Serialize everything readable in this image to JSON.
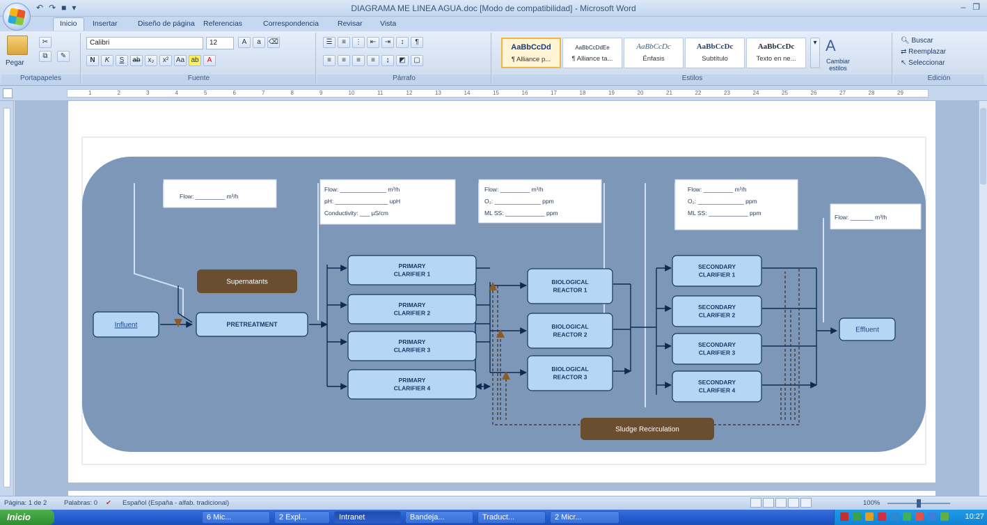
{
  "window": {
    "title": "DIAGRAMA ME LINEA AGUA.doc [Modo de compatibilidad] - Microsoft Word"
  },
  "tabs": [
    "Inicio",
    "Insertar",
    "Diseño de página",
    "Referencias",
    "Correspondencia",
    "Revisar",
    "Vista"
  ],
  "ribbon": {
    "clipboard": {
      "paste": "Pegar",
      "label": "Portapapeles"
    },
    "font": {
      "name": "Calibri",
      "size": "12",
      "label": "Fuente"
    },
    "paragraph": {
      "label": "Párrafo"
    },
    "styles": {
      "label": "Estilos",
      "items": [
        {
          "sample": "AaBbCcDd",
          "name": "¶ Alliance p..."
        },
        {
          "sample": "AaBbCcDdEe",
          "name": "¶ Alliance ta..."
        },
        {
          "sample": "AaBbCcDc",
          "name": "Énfasis"
        },
        {
          "sample": "AaBbCcDc",
          "name": "Subtítulo"
        },
        {
          "sample": "AaBbCcDc",
          "name": "Texto en ne..."
        }
      ],
      "change": "Cambiar estilos"
    },
    "editing": {
      "label": "Edición",
      "find": "Buscar",
      "replace": "Reemplazar",
      "select": "Seleccionar"
    }
  },
  "ruler": {
    "ticks": [
      "1",
      "2",
      "3",
      "4",
      "5",
      "6",
      "7",
      "8",
      "9",
      "10",
      "11",
      "12",
      "13",
      "14",
      "15",
      "16",
      "17",
      "18",
      "19",
      "20",
      "21",
      "22",
      "23",
      "24",
      "25",
      "26",
      "27",
      "28",
      "29"
    ]
  },
  "diagram": {
    "info_boxes": {
      "influent": {
        "line1": "Flow: _________ m³/h"
      },
      "primary": {
        "line1": "Flow: ______________ m³/h",
        "line2": "pH: ________________ upH",
        "line3": "Conductivity: ___ µS/cm"
      },
      "biological": {
        "line1": "Flow: _________ m³/h",
        "line2": "O₂: ______________ ppm",
        "line3": "ML SS: ____________ ppm"
      },
      "secondary": {
        "line1": "Flow: _________ m³/h",
        "line2": "O₂: ______________ ppm",
        "line3": "ML SS: ____________ ppm"
      },
      "effluent": {
        "line1": "Flow: _______ m³/h"
      }
    },
    "nodes": {
      "influent": "Influent",
      "supernatants": "Supernatants",
      "pretreatment": "PRETREATMENT",
      "primary1": [
        "PRIMARY",
        "CLARIFIER 1"
      ],
      "primary2": [
        "PRIMARY",
        "CLARIFIER 2"
      ],
      "primary3": [
        "PRIMARY",
        "CLARIFIER 3"
      ],
      "primary4": [
        "PRIMARY",
        "CLARIFIER 4"
      ],
      "bio1": [
        "BIOLOGICAL",
        "REACTOR 1"
      ],
      "bio2": [
        "BIOLOGICAL",
        "REACTOR 2"
      ],
      "bio3": [
        "BIOLOGICAL",
        "REACTOR 3"
      ],
      "secondary1": [
        "SECONDARY",
        "CLARIFIER 1"
      ],
      "secondary2": [
        "SECONDARY",
        "CLARIFIER 2"
      ],
      "secondary3": [
        "SECONDARY",
        "CLARIFIER 3"
      ],
      "secondary4": [
        "SECONDARY",
        "CLARIFIER 4"
      ],
      "effluent": "Effluent",
      "sludge": "Sludge Recirculation"
    }
  },
  "status": {
    "page": "Página: 1 de 2",
    "words": "Palabras: 0",
    "language": "Español (España - alfab. tradicional)",
    "zoom": "100%"
  },
  "taskbar": {
    "start": "Inicio",
    "items": [
      "6 Mic...",
      "2 Expl...",
      "Intranet",
      "Bandeja...",
      "Traduct...",
      "2 Micr..."
    ],
    "clock": "10:27"
  },
  "colors": {
    "canvas": "#7c97b8",
    "node_fill": "#b6d6f5",
    "node_border": "#14365f",
    "brown": "#6b4d2f",
    "arrow": "#0d2b52"
  }
}
